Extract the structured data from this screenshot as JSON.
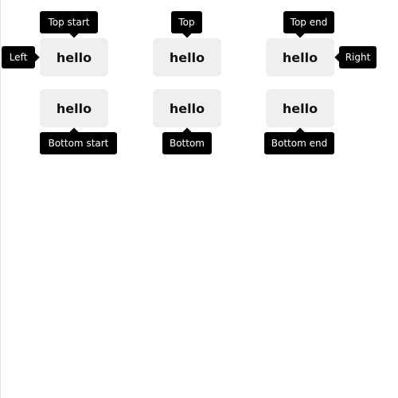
{
  "buttons": {
    "top_start": "hello",
    "top": "hello",
    "top_end": "hello",
    "bottom_start": "hello",
    "bottom": "hello",
    "bottom_end": "hello"
  },
  "tooltips": {
    "top_start": "Top start",
    "top": "Top",
    "top_end": "Top end",
    "left": "Left",
    "right": "Right",
    "bottom_start": "Bottom start",
    "bottom": "Bottom",
    "bottom_end": "Bottom end"
  }
}
